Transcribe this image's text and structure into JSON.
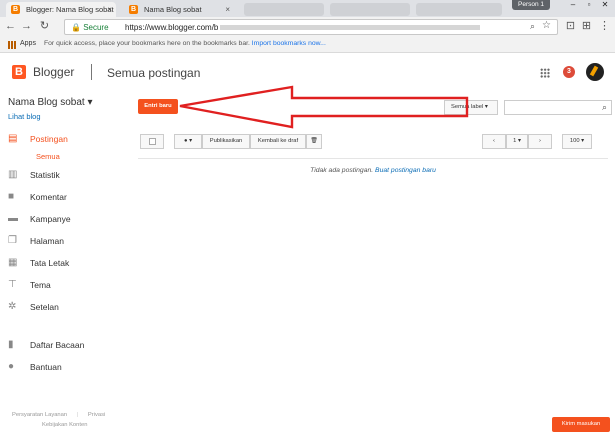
{
  "browser": {
    "tabs": [
      {
        "title": "Blogger: Nama Blog sobat",
        "active": true
      },
      {
        "title": "Nama Blog sobat",
        "active": false
      }
    ],
    "person": "Person 1",
    "secure_label": "Secure",
    "url": "https://www.blogger.com/b",
    "apps_label": "Apps",
    "bookmark_hint": "For quick access, place your bookmarks here on the bookmarks bar.",
    "bookmark_import": "Import bookmarks now..."
  },
  "header": {
    "brand": "Blogger",
    "page_title": "Semua postingan",
    "notification_count": "3"
  },
  "sidebar": {
    "blog_name": "Nama Blog sobat",
    "view_blog": "Lihat blog",
    "items": [
      {
        "label": "Postingan",
        "icon": "posts-icon"
      },
      {
        "label": "Statistik",
        "icon": "stats-icon"
      },
      {
        "label": "Komentar",
        "icon": "comments-icon"
      },
      {
        "label": "Kampanye",
        "icon": "campaign-icon"
      },
      {
        "label": "Halaman",
        "icon": "pages-icon"
      },
      {
        "label": "Tata Letak",
        "icon": "layout-icon"
      },
      {
        "label": "Tema",
        "icon": "theme-icon"
      },
      {
        "label": "Setelan",
        "icon": "settings-icon"
      },
      {
        "label": "Daftar Bacaan",
        "icon": "bookmark-icon"
      },
      {
        "label": "Bantuan",
        "icon": "help-icon"
      }
    ],
    "sub_item": "Semua",
    "footer": {
      "terms": "Persyaratan Layanan",
      "privacy": "Privasi",
      "content_policy": "Kebijakan Konten"
    }
  },
  "main": {
    "new_post": "Entri baru",
    "label_filter": "Semua label",
    "toolbar": {
      "publish": "Publikasikan",
      "revert": "Kembali ke draf",
      "page_number": "1",
      "page_size": "100"
    },
    "empty_message": "Tidak ada postingan.",
    "empty_link": "Buat postingan baru"
  },
  "feedback": "Kirim masukan",
  "colors": {
    "accent": "#f4511e",
    "annotation_arrow": "#e02020"
  }
}
